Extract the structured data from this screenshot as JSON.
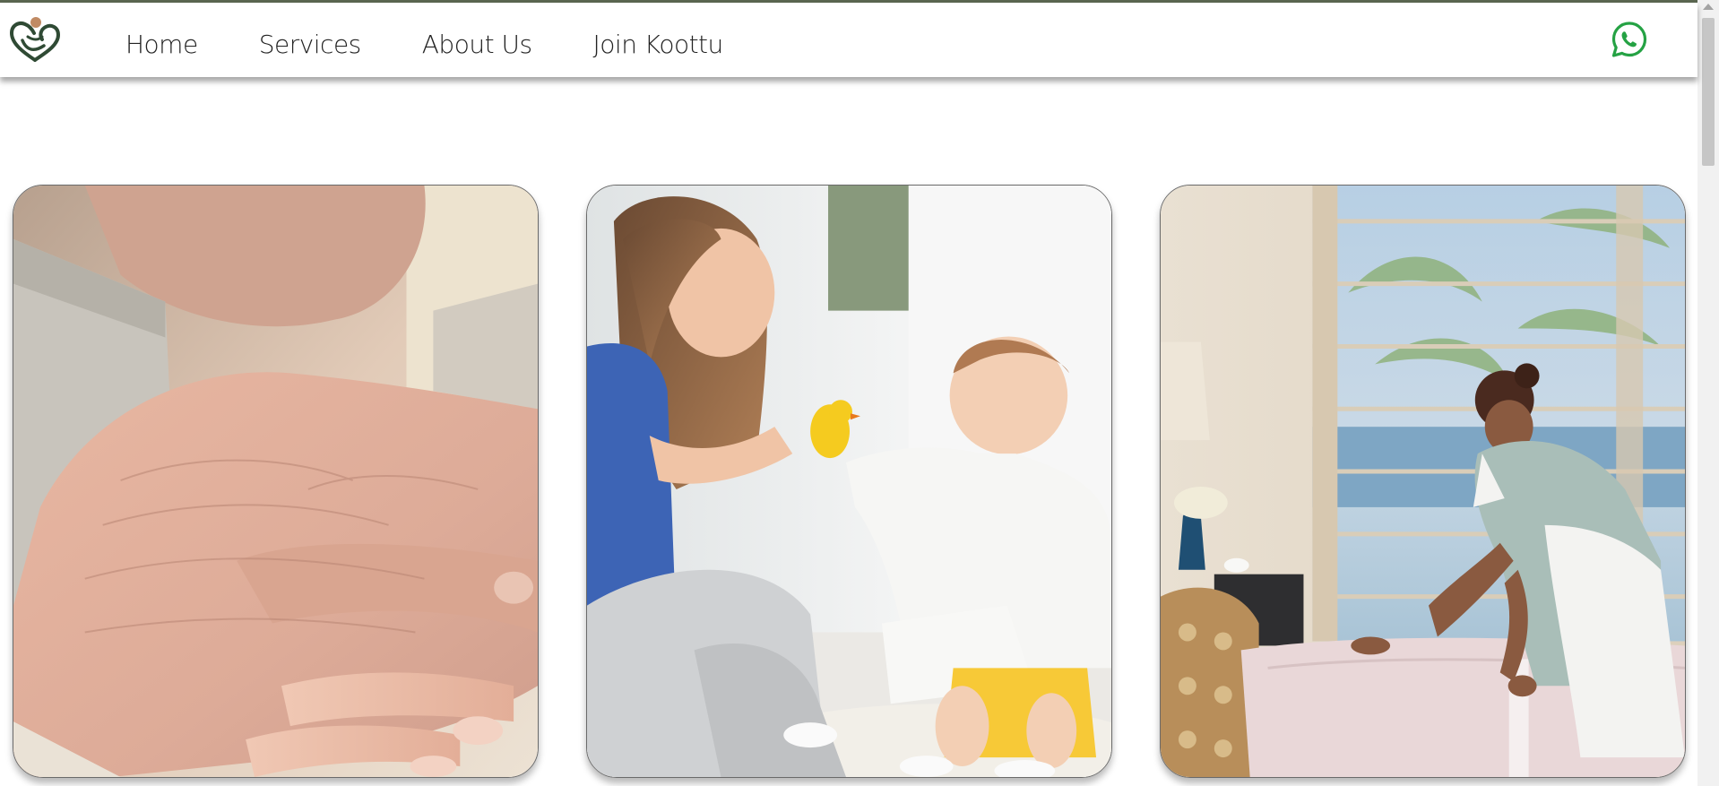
{
  "header": {
    "logo_icon": "heart-hands-logo-icon",
    "nav": [
      {
        "label": "Home"
      },
      {
        "label": "Services"
      },
      {
        "label": "About Us"
      },
      {
        "label": "Join Koottu"
      }
    ],
    "whatsapp_icon": "whatsapp-icon"
  },
  "colors": {
    "accent_dark_green": "#2f4a34",
    "logo_dot": "#c08a63",
    "whatsapp_green": "#25a244"
  },
  "cards": [
    {
      "image": "elderly-hands-photo"
    },
    {
      "image": "mother-and-baby-photo"
    },
    {
      "image": "housekeeping-photo"
    }
  ]
}
